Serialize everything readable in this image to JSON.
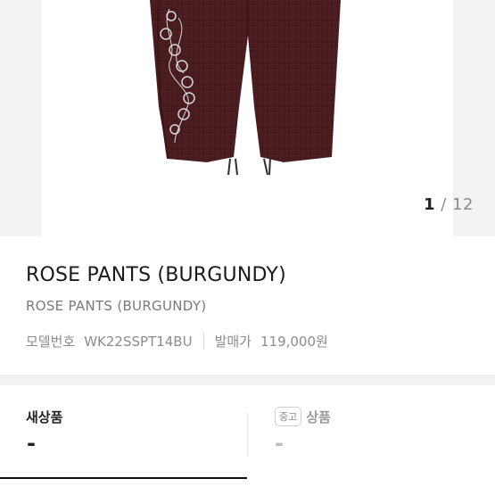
{
  "gallery": {
    "current": "1",
    "separator": "/",
    "total": "12",
    "image_icon": "product-photo-burgundy-pants"
  },
  "product": {
    "title": "ROSE PANTS (BURGUNDY)",
    "subtitle": "ROSE PANTS (BURGUNDY)",
    "model_label": "모델번호",
    "model_value": "WK22SSPT14BU",
    "release_label": "발매가",
    "release_value": "119,000원"
  },
  "tabs": {
    "new_label": "새상품",
    "new_price": "-",
    "used_badge": "중고",
    "used_label": "상품",
    "used_price": "-"
  },
  "colors": {
    "pants": "#4b1d1f",
    "accent": "#111111"
  }
}
